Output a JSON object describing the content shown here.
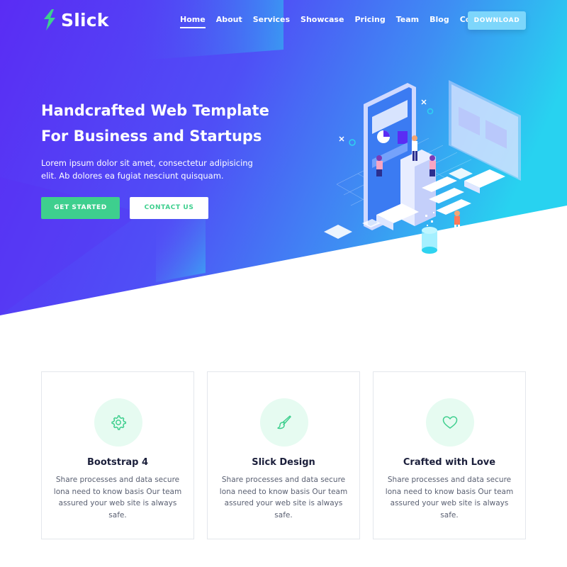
{
  "brand": {
    "name": "Slick",
    "accent": "#3ecf8e",
    "gradient": [
      "#5b2df5",
      "#4a6cf7",
      "#2ed3f0"
    ]
  },
  "nav": {
    "items": [
      {
        "label": "Home",
        "active": true
      },
      {
        "label": "About"
      },
      {
        "label": "Services"
      },
      {
        "label": "Showcase"
      },
      {
        "label": "Pricing"
      },
      {
        "label": "Team"
      },
      {
        "label": "Blog"
      },
      {
        "label": "Contact"
      }
    ],
    "cta_label": "DOWNLOAD"
  },
  "hero": {
    "title_line1": "Handcrafted Web Template",
    "title_line2": "For Business and Startups",
    "subtitle": "Lorem ipsum dolor sit amet, consectetur adipisicing elit. Ab dolores ea fugiat nesciunt quisquam.",
    "primary_button": "GET STARTED",
    "secondary_button": "CONTACT US"
  },
  "features": [
    {
      "icon": "gear-icon",
      "title": "Bootstrap 4",
      "text": "Share processes and data secure lona need to know basis Our team assured your web site is always safe."
    },
    {
      "icon": "brush-icon",
      "title": "Slick Design",
      "text": "Share processes and data secure lona need to know basis Our team assured your web site is always safe."
    },
    {
      "icon": "heart-icon",
      "title": "Crafted with Love",
      "text": "Share processes and data secure lona need to know basis Our team assured your web site is always safe."
    }
  ]
}
